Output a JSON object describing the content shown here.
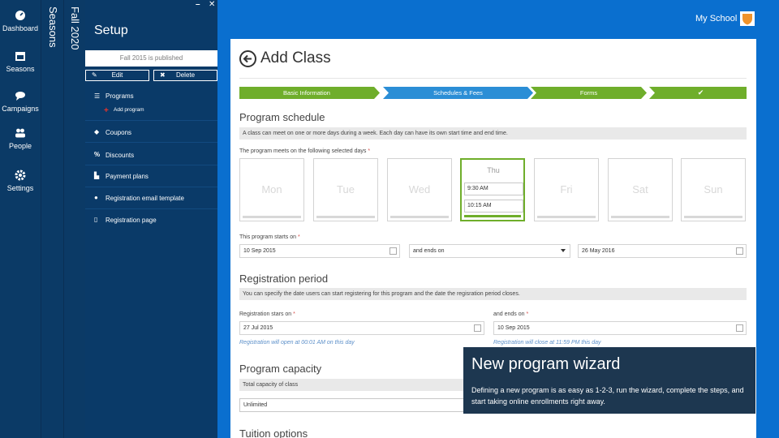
{
  "rail": {
    "items": [
      {
        "label": "Dashboard",
        "icon": "dashboard-icon"
      },
      {
        "label": "Seasons",
        "icon": "calendar-icon"
      },
      {
        "label": "Campaigns",
        "icon": "chat-icon"
      },
      {
        "label": "People",
        "icon": "people-icon"
      },
      {
        "label": "Settings",
        "icon": "gear-icon"
      }
    ]
  },
  "columns": {
    "seasons": "Seasons",
    "fall": "Fall 2020"
  },
  "setup": {
    "title": "Setup",
    "published": "Fall 2015 is published",
    "edit": "Edit",
    "delete": "Delete",
    "menu": {
      "programs": "Programs",
      "add_program": "Add program",
      "coupons": "Coupons",
      "discounts": "Discounts",
      "payment_plans": "Payment plans",
      "reg_email": "Registration email template",
      "reg_page": "Registration page"
    }
  },
  "header": {
    "school": "My School"
  },
  "card": {
    "title": "Add Class",
    "steps": [
      "Basic Information",
      "Schedules & Fees",
      "Forms",
      "✔"
    ],
    "schedule": {
      "title": "Program schedule",
      "note": "A class can meet on one or more days during a week. Each day can have its own start time and end time.",
      "days_label": "The program meets on the following selected days",
      "days": [
        "Mon",
        "Tue",
        "Wed",
        "Thu",
        "Fri",
        "Sat",
        "Sun"
      ],
      "start_time": "9:30 AM",
      "end_time": "10:15 AM",
      "starts_label": "This program starts on",
      "start_date": "10 Sep 2015",
      "ends_select": "and ends on",
      "end_date": "26 May 2016"
    },
    "registration": {
      "title": "Registration period",
      "note": "You can specify the date users can start registering for this program and the date the regisration period closes.",
      "starts_label": "Registration stars on",
      "start_date": "27 Jul 2015",
      "start_hint": "Registration will open at 00:01 AM on this day",
      "ends_label": "and ends on",
      "end_date": "10 Sep 2015",
      "end_hint": "Registration will close at 11:59 PM this day"
    },
    "capacity": {
      "title": "Program capacity",
      "note": "Total capacity of class",
      "value": "Unlimited"
    },
    "tuition": {
      "title": "Tuition options"
    }
  },
  "tooltip": {
    "title": "New program wizard",
    "body": "Defining a new program is as easy as 1-2-3, run the wizard, complete the steps, and start taking online enrollments right away."
  },
  "colors": {
    "green": "#6fae2b",
    "blue": "#2b8ed6",
    "navy": "#0b3a66"
  }
}
